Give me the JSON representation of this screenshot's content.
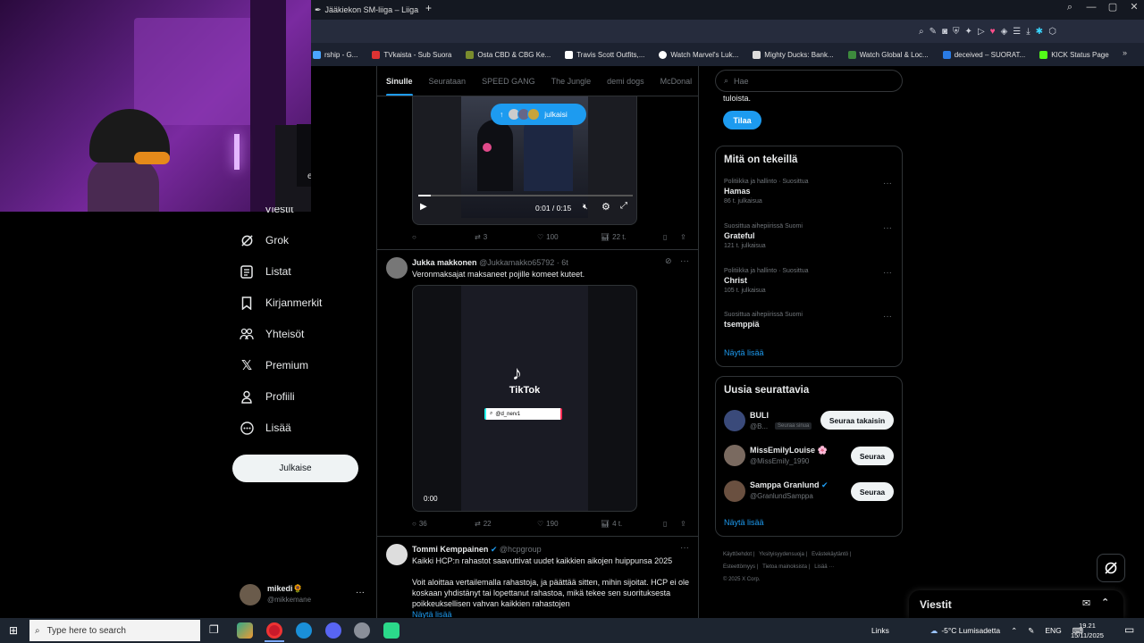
{
  "browser": {
    "tab_title": "Jääkiekon SM-liiga – Liiga",
    "new_tab": "+",
    "window_controls": [
      "—",
      "▢",
      "✕"
    ],
    "bookmarks": [
      {
        "label": "rship - G...",
        "color": "#4aa6ff"
      },
      {
        "label": "TVkaista - Sub Suora",
        "color": "#d33"
      },
      {
        "label": "Osta CBD & CBG Ke...",
        "color": "#7a8c2d"
      },
      {
        "label": "Travis Scott Outfits,...",
        "color": "#fff"
      },
      {
        "label": "Watch Marvel's Luk...",
        "color": "#fff"
      },
      {
        "label": "Mighty Ducks: Bank...",
        "color": "#ddd"
      },
      {
        "label": "Watch Global & Loc...",
        "color": "#3d8a3d"
      },
      {
        "label": "deceived – SUORAT...",
        "color": "#2a7be4"
      },
      {
        "label": "KICK Status Page",
        "color": "#53fc18"
      }
    ],
    "bookmarks_more": "»"
  },
  "nav": {
    "partial_top": "Viestit",
    "items": [
      {
        "label": "Grok",
        "icon": "grok-icon"
      },
      {
        "label": "Listat",
        "icon": "list-icon"
      },
      {
        "label": "Kirjanmerkit",
        "icon": "bookmark-icon"
      },
      {
        "label": "Yhteisöt",
        "icon": "communities-icon"
      },
      {
        "label": "Premium",
        "icon": "x-logo-icon"
      },
      {
        "label": "Profiili",
        "icon": "profile-icon"
      },
      {
        "label": "Lisää",
        "icon": "more-circle-icon"
      }
    ],
    "post_button": "Julkaise",
    "account": {
      "name": "mikedi",
      "emoji": "🌻",
      "handle": "@mikkemane",
      "more": "···"
    }
  },
  "webcam": {
    "partial_text": "et"
  },
  "feed": {
    "tabs": [
      "Sinulle",
      "Seurataan",
      "SPEED GANG",
      "The Jungle",
      "demi dogs",
      "McDonal"
    ],
    "new_posts_pill": "julkaisi",
    "video1": {
      "time": "0:01 / 0:15",
      "replies": "",
      "reposts": "3",
      "likes": "100",
      "views": "22 t."
    },
    "post2": {
      "name": "Jukka makkonen",
      "handle": "@Jukkamakko65792",
      "time": "· 6t",
      "text": "Veronmaksajat maksaneet pojille komeet kuteet.",
      "tiktok_label": "TikTok",
      "tiktok_handle": "@d_nerv1",
      "video_time": "0:00",
      "replies": "36",
      "reposts": "22",
      "likes": "190",
      "views": "4 t."
    },
    "post3": {
      "name": "Tommi Kemppainen",
      "handle": "@hcpgroup",
      "line1": "Kaikki HCP:n rahastot saavuttivat uudet kaikkien aikojen huippunsa 2025",
      "para": "Voit aloittaa vertailemalla rahastoja, ja päättää sitten, mihin sijoitat. HCP ei ole koskaan yhdistänyt tai lopettanut rahastoa, mikä tekee sen suorituksesta poikkeuksellisen vahvan kaikkien rahastojen",
      "more": "Näytä lisää"
    }
  },
  "right": {
    "search_placeholder": "Hae",
    "subscribe_tail": "tuloista.",
    "subscribe_btn": "Tilaa",
    "trending_title": "Mitä on tekeillä",
    "trends": [
      {
        "cat": "Politiikka ja hallinto · Suosittua",
        "name": "Hamas",
        "count": "86 t. julkaisua"
      },
      {
        "cat": "Suosittua aihepiirissä Suomi",
        "name": "Grateful",
        "count": "121 t. julkaisua"
      },
      {
        "cat": "Politiikka ja hallinto · Suosittua",
        "name": "Christ",
        "count": "105 t. julkaisua"
      },
      {
        "cat": "Suosittua aihepiirissä Suomi",
        "name": "tsemppiä",
        "count": ""
      }
    ],
    "show_more": "Näytä lisää",
    "who_title": "Uusia seurattavia",
    "who": [
      {
        "name": "BULI",
        "handle": "@B...",
        "badge": "Seuraa sinua",
        "btn": "Seuraa takaisin",
        "color": "#3a4a7a"
      },
      {
        "name": "MissEmilyLouise 🌸",
        "handle": "@MissEmily_1990",
        "badge": "",
        "btn": "Seuraa",
        "color": "#7a6a60"
      },
      {
        "name": "Samppa Granlund",
        "handle": "@GranlundSamppa",
        "badge": "",
        "btn": "Seuraa",
        "color": "#6a5040"
      }
    ],
    "who_more": "Näytä lisää",
    "footer": [
      "Käyttöehdot",
      "Yksityisyydensuoja",
      "Evästekäytäntö",
      "Esteettömyys",
      "Tietoa mainoksista",
      "Lisää ···",
      "© 2025 X Corp."
    ],
    "messages": "Viestit"
  },
  "taskbar": {
    "search_placeholder": "Type here to search",
    "links": "Links",
    "weather": "-5°C  Lumisadetta",
    "lang": "ENG",
    "time": "19.21",
    "date": "15/11/2025"
  }
}
